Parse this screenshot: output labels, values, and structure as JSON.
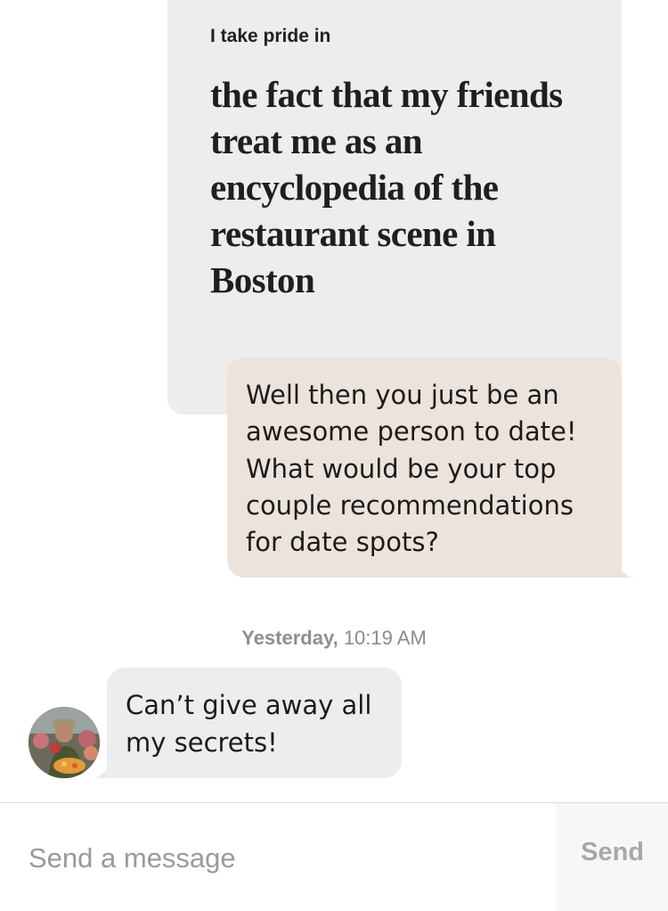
{
  "prompt_card": {
    "label": "I take pride in",
    "answer": "the fact that my friends treat me as an encyclopedia of the restaurant scene in Boston"
  },
  "outgoing_message": {
    "text": "Well then you just be an awesome person to date! What would be your top couple recommendations for date spots?"
  },
  "timestamp": {
    "day": "Yesterday,",
    "time": "10:19 AM"
  },
  "incoming_message": {
    "text": "Can’t give away all my secrets!",
    "avatar_icon": "profile-photo-avatar"
  },
  "composer": {
    "placeholder": "Send a message",
    "value": "",
    "send_label": "Send"
  },
  "colors": {
    "prompt_card_bg": "#ededed",
    "outgoing_bubble_bg": "#ece3dc",
    "incoming_bubble_bg": "#ededed",
    "send_disabled": "#a8a8a8"
  }
}
